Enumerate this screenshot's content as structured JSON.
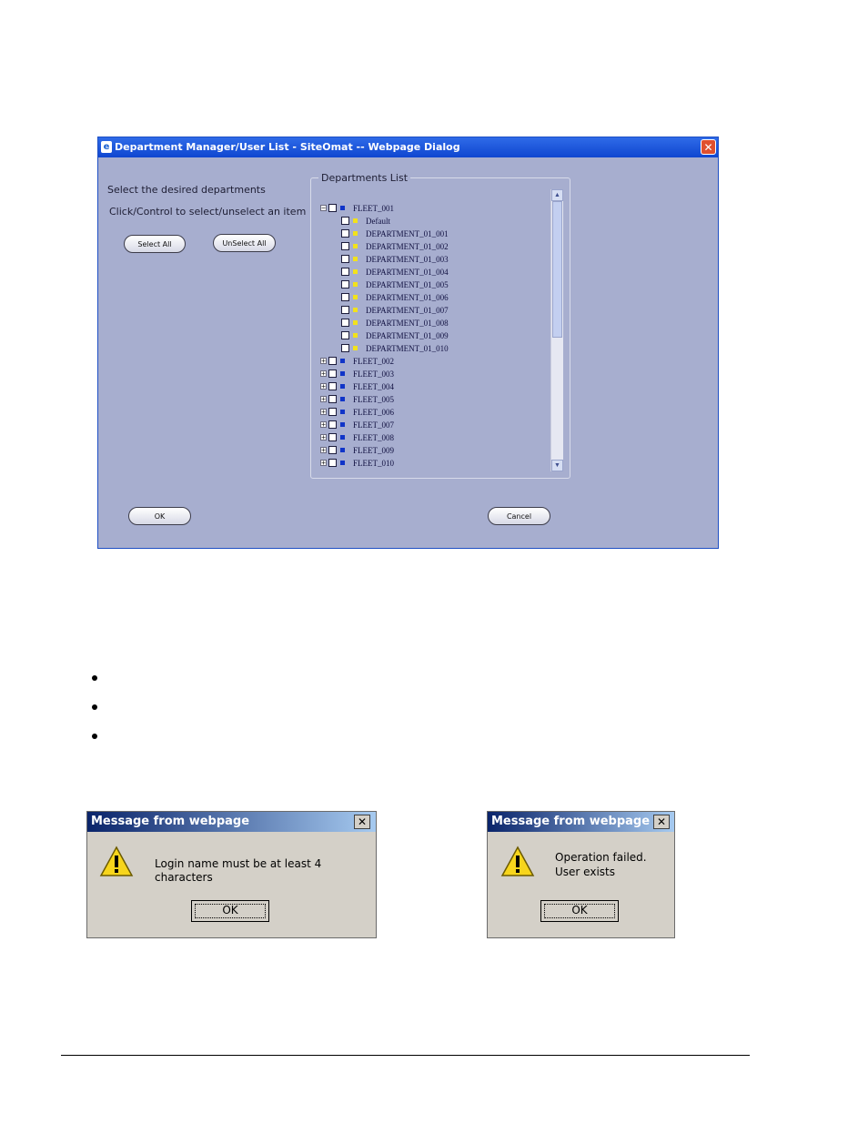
{
  "dialog": {
    "title": "Department Manager/User List - SiteOmat -- Webpage Dialog",
    "instruction_line1": "Select the desired departments",
    "instruction_line2": "Click/Control to select/unselect an item",
    "select_all": "Select All",
    "unselect_all": "UnSelect All",
    "group_title": "Departments List",
    "ok": "OK",
    "cancel": "Cancel",
    "tree": [
      {
        "label": "FLEET_001",
        "level": 0,
        "expanded": true,
        "color": "#1034c8"
      },
      {
        "label": "Default",
        "level": 1,
        "color": "#f2e21c"
      },
      {
        "label": "DEPARTMENT_01_001",
        "level": 1,
        "color": "#f2e21c"
      },
      {
        "label": "DEPARTMENT_01_002",
        "level": 1,
        "color": "#f2e21c"
      },
      {
        "label": "DEPARTMENT_01_003",
        "level": 1,
        "color": "#f2e21c"
      },
      {
        "label": "DEPARTMENT_01_004",
        "level": 1,
        "color": "#f2e21c"
      },
      {
        "label": "DEPARTMENT_01_005",
        "level": 1,
        "color": "#f2e21c"
      },
      {
        "label": "DEPARTMENT_01_006",
        "level": 1,
        "color": "#f2e21c"
      },
      {
        "label": "DEPARTMENT_01_007",
        "level": 1,
        "color": "#f2e21c"
      },
      {
        "label": "DEPARTMENT_01_008",
        "level": 1,
        "color": "#f2e21c"
      },
      {
        "label": "DEPARTMENT_01_009",
        "level": 1,
        "color": "#f2e21c"
      },
      {
        "label": "DEPARTMENT_01_010",
        "level": 1,
        "color": "#f2e21c"
      },
      {
        "label": "FLEET_002",
        "level": 0,
        "expanded": false,
        "color": "#1034c8"
      },
      {
        "label": "FLEET_003",
        "level": 0,
        "expanded": false,
        "color": "#1034c8"
      },
      {
        "label": "FLEET_004",
        "level": 0,
        "expanded": false,
        "color": "#1034c8"
      },
      {
        "label": "FLEET_005",
        "level": 0,
        "expanded": false,
        "color": "#1034c8"
      },
      {
        "label": "FLEET_006",
        "level": 0,
        "expanded": false,
        "color": "#1034c8"
      },
      {
        "label": "FLEET_007",
        "level": 0,
        "expanded": false,
        "color": "#1034c8"
      },
      {
        "label": "FLEET_008",
        "level": 0,
        "expanded": false,
        "color": "#1034c8"
      },
      {
        "label": "FLEET_009",
        "level": 0,
        "expanded": false,
        "color": "#1034c8"
      },
      {
        "label": "FLEET_010",
        "level": 0,
        "expanded": false,
        "color": "#1034c8"
      }
    ]
  },
  "message_box_1": {
    "title": "Message from webpage",
    "message": "Login name must be at least 4 characters",
    "ok": "OK",
    "icon": "warning-icon"
  },
  "message_box_2": {
    "title": "Message from webpage",
    "message_line1": "Operation failed.",
    "message_line2": "User exists",
    "ok": "OK",
    "icon": "warning-icon"
  }
}
